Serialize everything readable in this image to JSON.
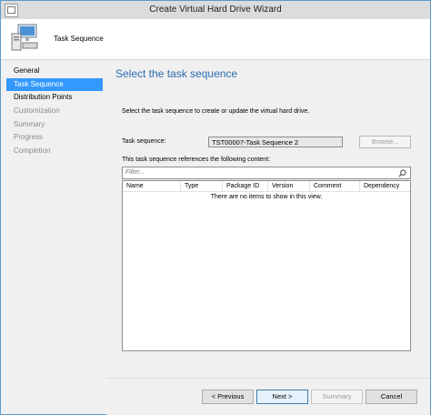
{
  "window": {
    "title": "Create Virtual Hard Drive Wizard"
  },
  "header": {
    "title": "Task Sequence",
    "icon": "computer-icon"
  },
  "nav": {
    "items": [
      {
        "label": "General",
        "state": "normal"
      },
      {
        "label": "Task Sequence",
        "state": "selected"
      },
      {
        "label": "Distribution Points",
        "state": "normal"
      },
      {
        "label": "Customization",
        "state": "disabled"
      },
      {
        "label": "Summary",
        "state": "disabled"
      },
      {
        "label": "Progress",
        "state": "disabled"
      },
      {
        "label": "Completion",
        "state": "disabled"
      }
    ]
  },
  "main": {
    "page_title": "Select the task sequence",
    "description": "Select the task sequence to create or update the virtual hard drive.",
    "task_sequence_label": "Task sequence:",
    "task_sequence_value": "TST00007-Task Sequence 2",
    "browse_label": "Browse...",
    "references_label": "This task sequence references the following content:",
    "filter_placeholder": "Filter...",
    "columns": [
      "Name",
      "Type",
      "Package ID",
      "Version",
      "Comment",
      "Dependency"
    ],
    "empty_message": "There are no items to show in this view."
  },
  "footer": {
    "previous_label": "< Previous",
    "next_label": "Next >",
    "summary_label": "Summary",
    "cancel_label": "Cancel"
  },
  "colors": {
    "accent": "#3399ff",
    "title_blue": "#2b6cb0"
  }
}
